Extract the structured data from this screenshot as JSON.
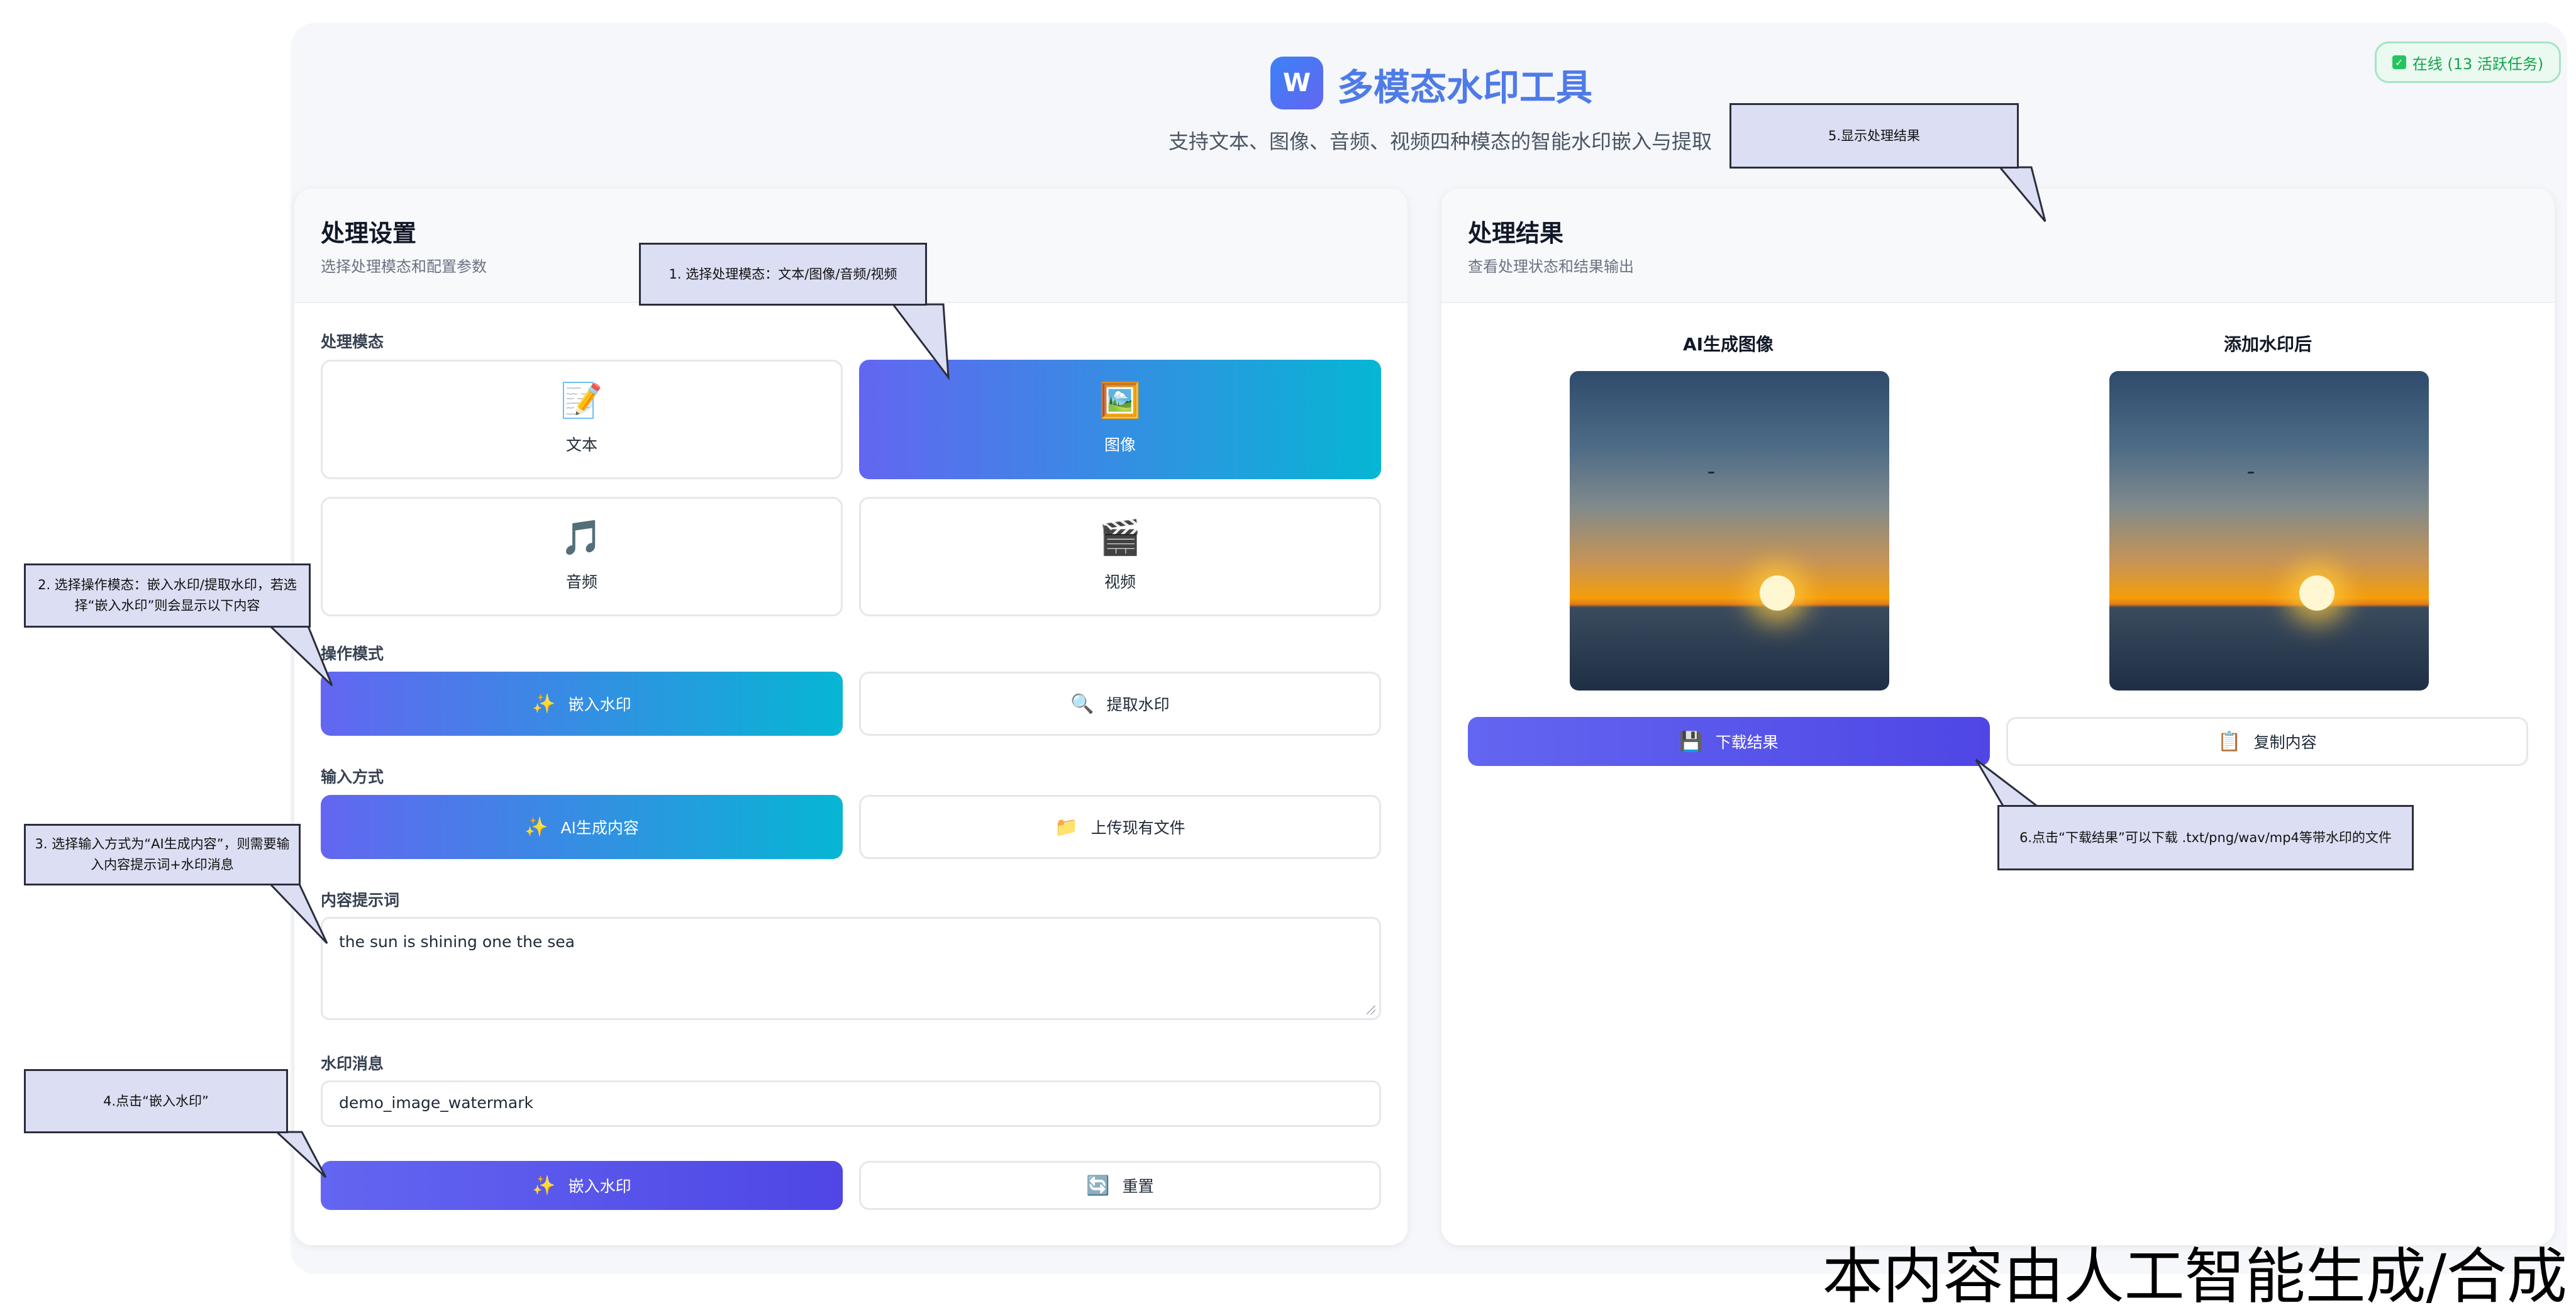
{
  "header": {
    "logo_letter": "W",
    "title": "多模态水印工具",
    "subtitle": "支持文本、图像、音频、视频四种模态的智能水印嵌入与提取",
    "status": "在线 (13 活跃任务)",
    "status_icon": "check-square-icon"
  },
  "left_panel": {
    "title": "处理设置",
    "subtitle": "选择处理模态和配置参数",
    "modality_label": "处理模态",
    "modalities": [
      {
        "label": "文本",
        "icon": "📝",
        "selected": false
      },
      {
        "label": "图像",
        "icon": "🖼️",
        "selected": true
      },
      {
        "label": "音频",
        "icon": "🎵",
        "selected": false
      },
      {
        "label": "视频",
        "icon": "🎬",
        "selected": false
      }
    ],
    "operation_label": "操作模式",
    "operations": [
      {
        "label": "嵌入水印",
        "icon": "✨",
        "selected": true
      },
      {
        "label": "提取水印",
        "icon": "🔍",
        "selected": false
      }
    ],
    "input_label": "输入方式",
    "input_methods": [
      {
        "label": "AI生成内容",
        "icon": "✨",
        "selected": true
      },
      {
        "label": "上传现有文件",
        "icon": "📁",
        "selected": false
      }
    ],
    "prompt_label": "内容提示词",
    "prompt_value": "the sun is shining one the sea",
    "watermark_label": "水印消息",
    "watermark_value": "demo_image_watermark",
    "submit_button": {
      "label": "嵌入水印",
      "icon": "✨"
    },
    "reset_button": {
      "label": "重置",
      "icon": "🔄"
    }
  },
  "right_panel": {
    "title": "处理结果",
    "subtitle": "查看处理状态和结果输出",
    "original_title": "AI生成图像",
    "watermarked_title": "添加水印后",
    "download_button": {
      "label": "下载结果",
      "icon": "💾"
    },
    "copy_button": {
      "label": "复制内容",
      "icon": "📋"
    }
  },
  "callouts": {
    "c1": "1. 选择处理模态：文本/图像/音频/视频",
    "c2": "2. 选择操作模态：嵌入水印/提取水印，若选择“嵌入水印”则会显示以下内容",
    "c3": "3. 选择输入方式为“AI生成内容”，则需要输入内容提示词+水印消息",
    "c4": "4.点击“嵌入水印”",
    "c5": "5.显示处理结果",
    "c6": "6.点击“下载结果”可以下载 .txt/png/wav/mp4等带水印的文件"
  },
  "ai_label": "本内容由人工智能生成/合成",
  "colors": {
    "accent_gradient_start": "#6366f1",
    "accent_gradient_end": "#06b6d4",
    "status_green": "#16a34a",
    "title_blue": "#4f7be8"
  }
}
